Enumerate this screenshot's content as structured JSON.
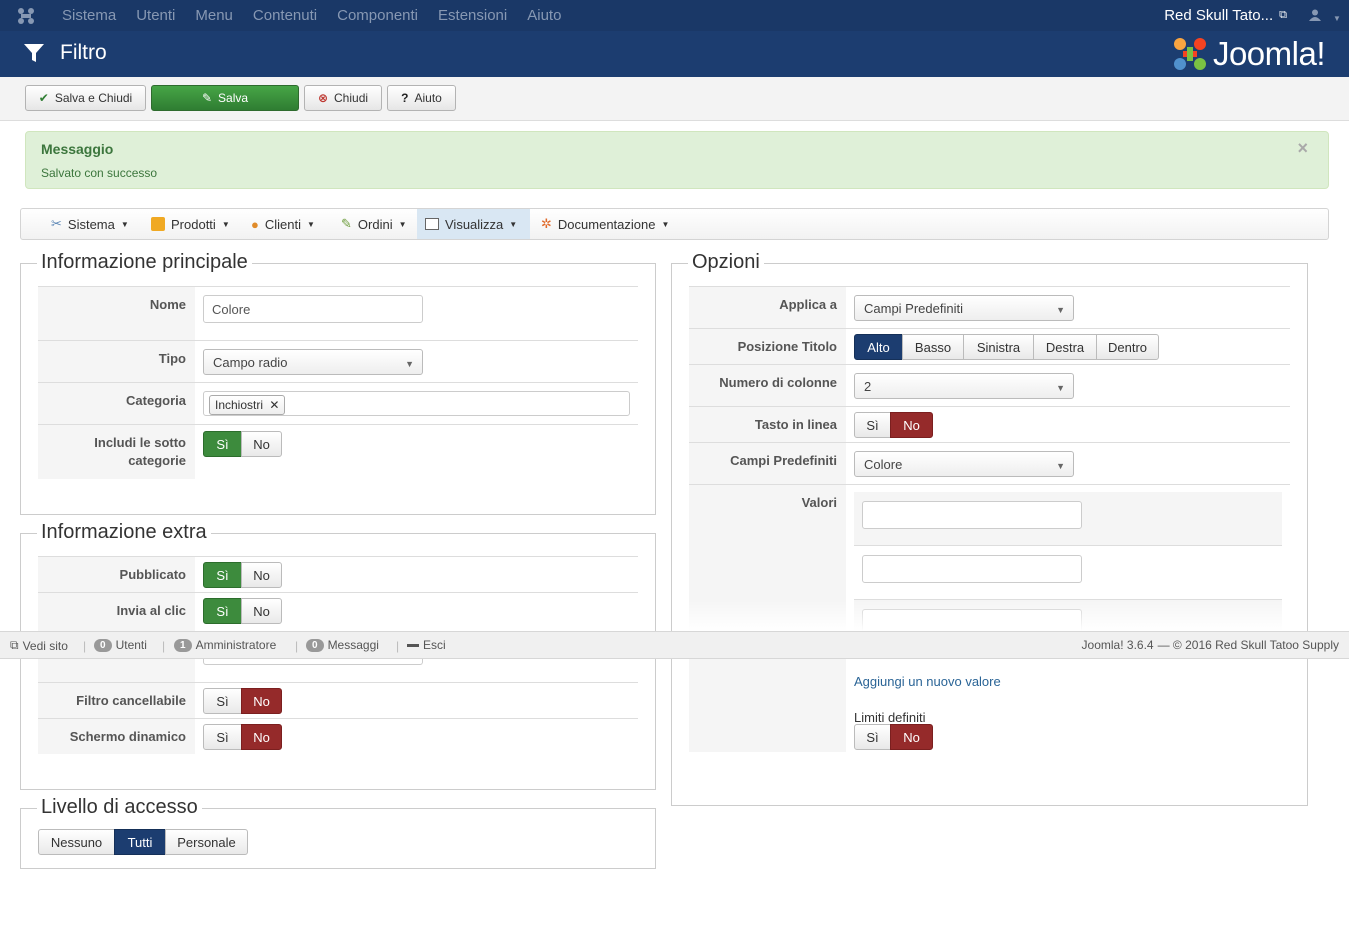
{
  "topnav": {
    "items": [
      "Sistema",
      "Utenti",
      "Menu",
      "Contenuti",
      "Componenti",
      "Estensioni",
      "Aiuto"
    ],
    "site_name": "Red Skull Tato...",
    "user_icon": "user-icon"
  },
  "header": {
    "title": "Filtro",
    "brand": "Joomla!"
  },
  "toolbar": {
    "save_close": "Salva e Chiudi",
    "save": "Salva",
    "close": "Chiudi",
    "help": "Aiuto"
  },
  "alert": {
    "heading": "Messaggio",
    "message": "Salvato con successo",
    "close": "×"
  },
  "component_menu": {
    "items": [
      "Sistema",
      "Prodotti",
      "Clienti",
      "Ordini",
      "Visualizza",
      "Documentazione"
    ],
    "active": "Visualizza"
  },
  "main_info": {
    "legend": "Informazione principale",
    "name_label": "Nome",
    "name_value": "Colore",
    "type_label": "Tipo",
    "type_value": "Campo radio",
    "category_label": "Categoria",
    "category_chip": "Inchiostri",
    "subcat_label_1": "Includi le sotto",
    "subcat_label_2": "categorie",
    "yes": "Sì",
    "no": "No"
  },
  "extra_info": {
    "legend": "Informazione extra",
    "published_label": "Pubblicato",
    "submit_label": "Invia al clic",
    "removable_label": "Filtro cancellabile",
    "dynamic_label": "Schermo dinamico"
  },
  "access": {
    "legend": "Livello di accesso",
    "options": [
      "Nessuno",
      "Tutti",
      "Personale"
    ],
    "selected": "Tutti"
  },
  "options": {
    "legend": "Opzioni",
    "apply_label": "Applica a",
    "apply_value": "Campi Predefiniti",
    "title_pos_label": "Posizione Titolo",
    "title_pos_options": [
      "Alto",
      "Basso",
      "Sinistra",
      "Destra",
      "Dentro"
    ],
    "title_pos_selected": "Alto",
    "columns_label": "Numero di colonne",
    "columns_value": "2",
    "inline_label": "Tasto in linea",
    "preset_label": "Campi Predefiniti",
    "preset_value": "Colore",
    "values_label": "Valori",
    "add_value": "Aggiungi un nuovo valore",
    "limits_label": "Limiti definiti"
  },
  "statusbar": {
    "view_site": "Vedi sito",
    "users_count": "0",
    "users": "Utenti",
    "admin_count": "1",
    "admin": "Amministratore",
    "messages_count": "0",
    "messages": "Messaggi",
    "logout": "Esci",
    "version": "Joomla! 3.6.4",
    "copyright": "— © 2016 Red Skull Tatoo Supply"
  },
  "colors": {
    "navbar": "#1a3867",
    "header": "#1c3d70",
    "green": "#3d8b3d",
    "red": "#952a2a",
    "alert_bg": "#dff0d8"
  }
}
